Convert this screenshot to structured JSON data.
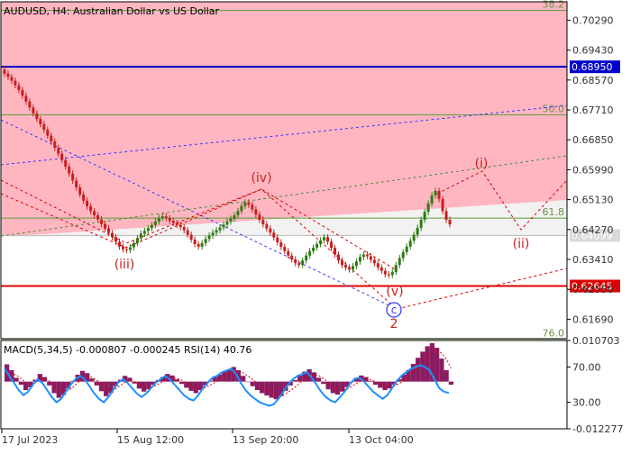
{
  "window": {
    "title": "AUDUSD, H4:  Australian Dollar vs US Dollar"
  },
  "colors": {
    "background": "#ffffff",
    "pink_zone": "#ffb6c1",
    "grey_zone": "#f2f2f2",
    "fib_line": "#5a9e3a",
    "blue_level": "#0000cc",
    "red_level": "#dd0000",
    "wave_label": "#c81e1e",
    "candle_up": "#2d7a10",
    "candle_down": "#c81e1e",
    "macd_hist": "#8b1c62",
    "rsi_line": "#1e90ff",
    "axis_text": "#333333",
    "current_price_box": "#d9d9d9"
  },
  "chart_data": [
    {
      "type": "candlestick",
      "title": "AUDUSD, H4:  Australian Dollar vs US Dollar",
      "y_ticks": [
        "0.70290",
        "0.69430",
        "0.68570",
        "0.67710",
        "0.66850",
        "0.65990",
        "0.65130",
        "0.64270",
        "0.63410",
        "0.62550",
        "0.61690"
      ],
      "ylim": [
        0.6113,
        0.7082
      ],
      "price_series": [
        0.6875,
        0.6866,
        0.6855,
        0.6842,
        0.6828,
        0.6812,
        0.6795,
        0.6778,
        0.6761,
        0.6745,
        0.673,
        0.6714,
        0.6697,
        0.668,
        0.6662,
        0.6645,
        0.6627,
        0.6608,
        0.6588,
        0.6568,
        0.6548,
        0.6528,
        0.651,
        0.6494,
        0.648,
        0.6468,
        0.6456,
        0.6443,
        0.643,
        0.6417,
        0.6405,
        0.6392,
        0.6378,
        0.637,
        0.6368,
        0.6376,
        0.6388,
        0.6402,
        0.6415,
        0.6423,
        0.6431,
        0.644,
        0.645,
        0.646,
        0.6465,
        0.646,
        0.6452,
        0.6446,
        0.644,
        0.6434,
        0.6425,
        0.6412,
        0.6398,
        0.6385,
        0.6378,
        0.6388,
        0.64,
        0.641,
        0.6418,
        0.6425,
        0.6433,
        0.6441,
        0.645,
        0.6458,
        0.6468,
        0.648,
        0.6495,
        0.6505,
        0.6498,
        0.6485,
        0.647,
        0.6455,
        0.6442,
        0.643,
        0.6418,
        0.6404,
        0.639,
        0.6377,
        0.6365,
        0.6352,
        0.6341,
        0.633,
        0.6325,
        0.6338,
        0.6352,
        0.6365,
        0.6375,
        0.6385,
        0.6396,
        0.6405,
        0.6392,
        0.6374,
        0.6355,
        0.6338,
        0.6325,
        0.6318,
        0.6312,
        0.6322,
        0.6335,
        0.6348,
        0.6355,
        0.635,
        0.634,
        0.633,
        0.6318,
        0.6308,
        0.6298,
        0.6296,
        0.6305,
        0.6325,
        0.6345,
        0.6362,
        0.6378,
        0.6395,
        0.6412,
        0.6432,
        0.6455,
        0.6478,
        0.6502,
        0.6525,
        0.6538,
        0.6515,
        0.648,
        0.6455,
        0.6442
      ],
      "horizontal_levels": [
        {
          "label": "38.2",
          "value": 0.7057
        },
        {
          "label": "0.68950",
          "value": 0.6895
        },
        {
          "label": "50.0",
          "value": 0.6757
        },
        {
          "label": "61.8",
          "value": 0.646
        },
        {
          "label": "0.64099",
          "value": 0.64099
        },
        {
          "label": "0.62645",
          "value": 0.62645
        },
        {
          "label": "76.0",
          "value": 0.6112
        }
      ],
      "wave_labels": [
        "(iii)",
        "(iv)",
        "(v)",
        "c",
        "2",
        "(i)",
        "(ii)"
      ],
      "x_ticks": [
        "17 Jul 2023",
        "15 Aug 12:00",
        "13 Sep 20:00",
        "13 Oct 04:00"
      ]
    },
    {
      "type": "bar",
      "title": "MACD(5,34,5) -0.000807 -0.000245 RSI(14) 40.76",
      "y_ticks": [
        "0.010703",
        "70.00",
        "30.00",
        "-0.012277"
      ],
      "ylim": [
        -0.012277,
        0.010703
      ],
      "macd_series": [
        0.0045,
        0.003,
        0.001,
        -0.0008,
        -0.0022,
        -0.0015,
        0.0005,
        0.002,
        0.0012,
        -0.001,
        -0.003,
        -0.0042,
        -0.0035,
        -0.0018,
        0.0002,
        0.0018,
        0.0028,
        0.0022,
        0.0008,
        -0.001,
        -0.0025,
        -0.0038,
        -0.003,
        -0.0012,
        0.0005,
        0.0015,
        0.001,
        -0.0005,
        -0.0018,
        -0.0026,
        -0.002,
        -0.0008,
        0.0004,
        0.0012,
        0.002,
        0.0016,
        0.0006,
        -0.0006,
        -0.0016,
        -0.0024,
        -0.003,
        -0.0022,
        -0.001,
        0.0002,
        0.0012,
        0.0018,
        0.0026,
        0.0032,
        0.0038,
        0.003,
        0.0015,
        0.0,
        -0.0012,
        -0.0022,
        -0.003,
        -0.0036,
        -0.0042,
        -0.0046,
        -0.0038,
        -0.0024,
        -0.001,
        0.0004,
        0.0016,
        0.0026,
        0.0032,
        0.0024,
        0.001,
        -0.0006,
        -0.002,
        -0.003,
        -0.0034,
        -0.0026,
        -0.0014,
        0.0,
        0.001,
        0.0016,
        0.0012,
        0.0002,
        -0.0008,
        -0.0016,
        -0.0022,
        -0.0018,
        -0.0008,
        0.0006,
        0.0018,
        0.003,
        0.0046,
        0.0062,
        0.0078,
        0.0092,
        0.01,
        0.0088,
        0.006,
        0.003,
        -0.0008
      ],
      "rsi_series": [
        68,
        60,
        52,
        44,
        38,
        42,
        50,
        56,
        52,
        44,
        36,
        30,
        34,
        42,
        50,
        56,
        60,
        56,
        48,
        40,
        34,
        30,
        36,
        44,
        52,
        56,
        52,
        46,
        40,
        36,
        40,
        46,
        52,
        56,
        60,
        56,
        50,
        44,
        38,
        34,
        32,
        38,
        46,
        52,
        58,
        60,
        64,
        66,
        68,
        62,
        52,
        44,
        38,
        34,
        30,
        28,
        26,
        28,
        34,
        42,
        50,
        56,
        60,
        62,
        64,
        58,
        50,
        42,
        36,
        32,
        30,
        36,
        42,
        50,
        56,
        58,
        54,
        48,
        42,
        38,
        34,
        38,
        46,
        54,
        60,
        64,
        68,
        70,
        72,
        70,
        66,
        56,
        46,
        42,
        40.76
      ]
    }
  ]
}
